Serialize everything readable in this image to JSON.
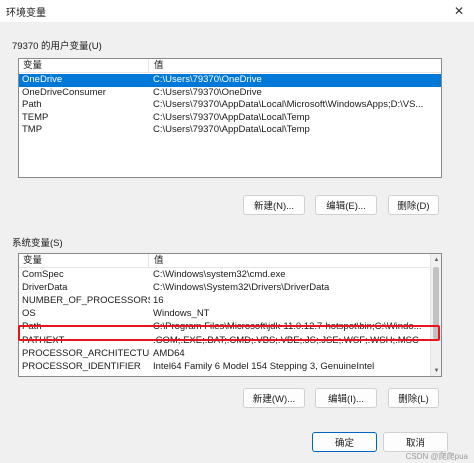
{
  "window": {
    "title": "环境变量",
    "close_glyph": "✕"
  },
  "user_vars": {
    "group_label": "79370 的用户变量(U)",
    "col_name": "变量",
    "col_value": "值",
    "rows": [
      {
        "name": "OneDrive",
        "value": "C:\\Users\\79370\\OneDrive",
        "selected": true
      },
      {
        "name": "OneDriveConsumer",
        "value": "C:\\Users\\79370\\OneDrive",
        "selected": false
      },
      {
        "name": "Path",
        "value": "C:\\Users\\79370\\AppData\\Local\\Microsoft\\WindowsApps;D:\\VS...",
        "selected": false
      },
      {
        "name": "TEMP",
        "value": "C:\\Users\\79370\\AppData\\Local\\Temp",
        "selected": false
      },
      {
        "name": "TMP",
        "value": "C:\\Users\\79370\\AppData\\Local\\Temp",
        "selected": false
      }
    ],
    "new_label": "新建(N)...",
    "edit_label": "编辑(E)...",
    "delete_label": "删除(D)"
  },
  "system_vars": {
    "group_label": "系统变量(S)",
    "col_name": "变量",
    "col_value": "值",
    "rows": [
      {
        "name": "ComSpec",
        "value": "C:\\Windows\\system32\\cmd.exe"
      },
      {
        "name": "DriverData",
        "value": "C:\\Windows\\System32\\Drivers\\DriverData"
      },
      {
        "name": "NUMBER_OF_PROCESSORS",
        "value": "16"
      },
      {
        "name": "OS",
        "value": "Windows_NT"
      },
      {
        "name": "Path",
        "value": "C:\\Program Files\\Microsoft\\jdk-11.0.12.7-hotspot\\bin;C:\\Windo..."
      },
      {
        "name": "PATHEXT",
        "value": ".COM;.EXE;.BAT;.CMD;.VBS;.VBE;.JS;.JSE;.WSF;.WSH;.MSC"
      },
      {
        "name": "PROCESSOR_ARCHITECTURE",
        "value": "AMD64"
      },
      {
        "name": "PROCESSOR_IDENTIFIER",
        "value": "Intel64 Family 6 Model 154 Stepping 3, GenuineIntel"
      }
    ],
    "new_label": "新建(W)...",
    "edit_label": "编辑(I)...",
    "delete_label": "删除(L)"
  },
  "footer": {
    "ok_label": "确定",
    "cancel_label": "取消",
    "watermark": "CSDN @爬爬pua"
  },
  "colors": {
    "selection": "#0078d7",
    "highlight_box": "#e8161b",
    "primary_border": "#0067c0"
  }
}
